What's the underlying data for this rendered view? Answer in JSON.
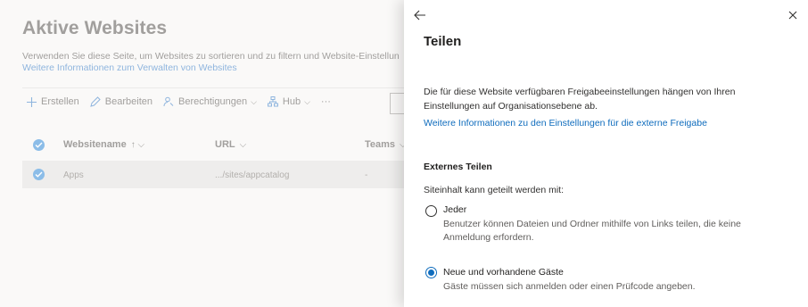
{
  "background": {
    "title": "Aktive Websites",
    "description": "Verwenden Sie diese Seite, um Websites zu sortieren und zu filtern und Website-Einstellun",
    "link": "Weitere Informationen zum Verwalten von Websites",
    "toolbar": {
      "create": "Erstellen",
      "edit": "Bearbeiten",
      "permissions": "Berechtigungen",
      "hub": "Hub",
      "more": "···"
    },
    "columns": {
      "name": "Websitename",
      "name_sort": "↑ ⌵",
      "url": "URL",
      "url_sort": "⌵",
      "teams": "Teams",
      "teams_sort": "⌵"
    },
    "rows": [
      {
        "name": "Apps",
        "url": ".../sites/appcatalog",
        "teams": "-"
      }
    ]
  },
  "panel": {
    "title": "Teilen",
    "intro": "Die für diese Website verfügbaren Freigabeeinstellungen hängen von Ihren Einstellungen auf Organisationsebene ab.",
    "intro_link": "Weitere Informationen zu den Einstellungen für die externe Freigabe",
    "section_title": "Externes Teilen",
    "section_sub": "Siteinhalt kann geteilt werden mit:",
    "options": [
      {
        "label": "Jeder",
        "description": "Benutzer können Dateien und Ordner mithilfe von Links teilen, die keine Anmeldung erfordern.",
        "selected": false
      },
      {
        "label": "Neue und vorhandene Gäste",
        "description": "Gäste müssen sich anmelden oder einen Prüfcode angeben.",
        "selected": true
      }
    ]
  },
  "colors": {
    "accent": "#0f6cbd",
    "muted_text": "#a19f9d"
  }
}
